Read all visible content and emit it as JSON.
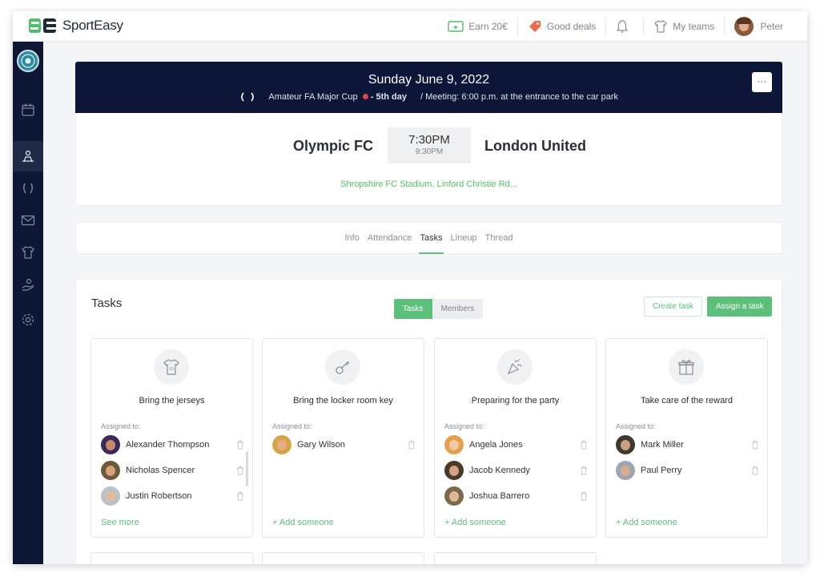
{
  "app": {
    "brand": "SportEasy",
    "brand_color": "#4fbf6a",
    "sidebar_color": "#0e1834"
  },
  "topbar": {
    "items": [
      {
        "label": "Earn 20€",
        "icon": "ticket-icon"
      },
      {
        "label": "Good deals",
        "icon": "tag-icon"
      },
      {
        "label": "",
        "icon": "bell-icon"
      },
      {
        "label": "My teams",
        "icon": "jersey-icon"
      },
      {
        "label": "Peter",
        "icon": "avatar"
      }
    ]
  },
  "sidebar": {
    "items": [
      "calendar-icon",
      "team-icon",
      "trophy-icon",
      "mail-icon",
      "jersey-icon",
      "hand-icon",
      "settings-icon"
    ],
    "active": "team-icon"
  },
  "event": {
    "date": "Sunday June 9, 2022",
    "competition": "Amateur FA Major Cup",
    "round": "- 5th day",
    "meeting": "/  Meeting: 6:00 p.m. at the entrance to the car park",
    "more": "···"
  },
  "match": {
    "home": "Olympic FC",
    "away": "London United",
    "time": "7:30PM",
    "end_time": "9:30PM",
    "stadium": "Shropshire FC Stadium, Linford Christie Rd..."
  },
  "tabs": [
    "Info",
    "Attendance",
    "Tasks",
    "Lineup",
    "Thread"
  ],
  "active_tab": "Tasks",
  "tasks": {
    "title": "Tasks",
    "toggle": [
      "Tasks",
      "Members"
    ],
    "create_label": "Create task",
    "assign_label": "Assign a task",
    "assigned_label": "Assigned to:",
    "cards": [
      {
        "title": "Bring the jerseys",
        "icon": "jersey-icon",
        "members": [
          "Alexander Thompson",
          "Nicholas Spencer",
          "Justin Robertson"
        ],
        "link": "See more"
      },
      {
        "title": "Bring the locker room key",
        "icon": "key-icon",
        "members": [
          "Gary Wilson"
        ],
        "link": "+ Add someone"
      },
      {
        "title": "Preparing for the party",
        "icon": "party-icon",
        "members": [
          "Angela Jones",
          "Jacob Kennedy",
          "Joshua Barrero"
        ],
        "link": "+ Add someone"
      },
      {
        "title": "Take care of the reward",
        "icon": "gift-icon",
        "members": [
          "Mark Miller",
          "Paul Perry"
        ],
        "link": "+ Add someone"
      }
    ]
  }
}
